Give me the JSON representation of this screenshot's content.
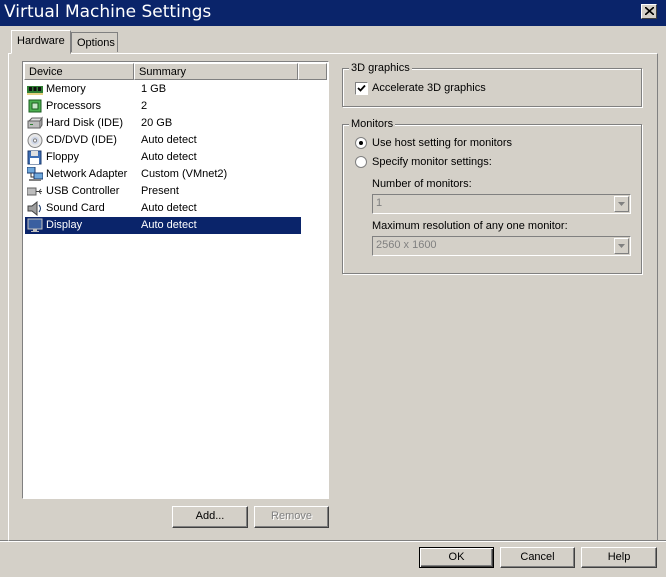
{
  "window": {
    "title": "Virtual Machine Settings"
  },
  "tabs": [
    {
      "label": "Hardware",
      "selected": true
    },
    {
      "label": "Options",
      "selected": false
    }
  ],
  "device_list": {
    "columns": [
      "Device",
      "Summary"
    ],
    "rows": [
      {
        "icon": "memory-icon",
        "device": "Memory",
        "summary": "1 GB"
      },
      {
        "icon": "processor-icon",
        "device": "Processors",
        "summary": "2"
      },
      {
        "icon": "hard-disk-icon",
        "device": "Hard Disk (IDE)",
        "summary": "20 GB"
      },
      {
        "icon": "cd-dvd-icon",
        "device": "CD/DVD (IDE)",
        "summary": "Auto detect"
      },
      {
        "icon": "floppy-icon",
        "device": "Floppy",
        "summary": "Auto detect"
      },
      {
        "icon": "network-adapter-icon",
        "device": "Network Adapter",
        "summary": "Custom (VMnet2)"
      },
      {
        "icon": "usb-icon",
        "device": "USB Controller",
        "summary": "Present"
      },
      {
        "icon": "sound-card-icon",
        "device": "Sound Card",
        "summary": "Auto detect"
      },
      {
        "icon": "display-icon",
        "device": "Display",
        "summary": "Auto detect",
        "selected": true
      }
    ]
  },
  "list_buttons": {
    "add": "Add...",
    "remove": "Remove"
  },
  "graphics_group": {
    "title": "3D graphics",
    "accelerate_label": "Accelerate 3D graphics",
    "accelerate_checked": true
  },
  "monitors_group": {
    "title": "Monitors",
    "use_host_label": "Use host setting for monitors",
    "specify_label": "Specify monitor settings:",
    "selected_option": "use_host",
    "num_monitors_label": "Number of monitors:",
    "num_monitors_value": "1",
    "max_res_label": "Maximum resolution of any one monitor:",
    "max_res_value": "2560 x 1600"
  },
  "dialog_buttons": {
    "ok": "OK",
    "cancel": "Cancel",
    "help": "Help"
  },
  "colors": {
    "titlebar": "#0a246a",
    "face": "#d4d0c8",
    "selection": "#0a246a"
  }
}
